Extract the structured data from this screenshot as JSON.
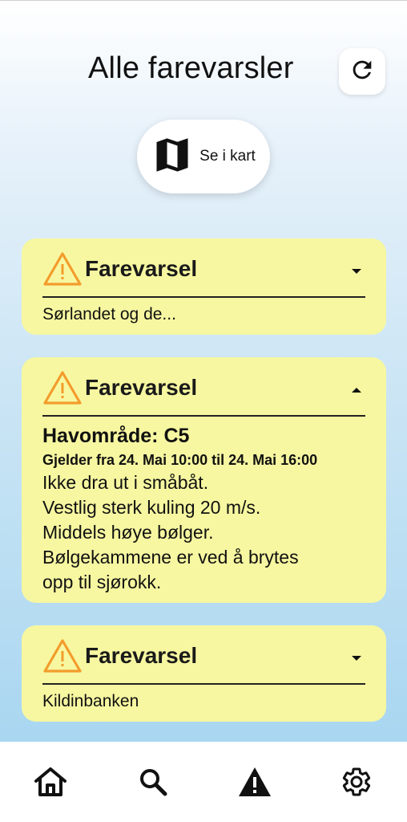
{
  "header": {
    "title": "Alle farevarsler",
    "refresh_icon": "refresh-icon"
  },
  "map_button": {
    "icon": "map-icon",
    "label": "Se i kart"
  },
  "colors": {
    "card_background": "#f7f7a1",
    "warning_orange": "#f39c2c"
  },
  "warnings": [
    {
      "title": "Farevarsel",
      "expanded": false,
      "summary": "Sørlandet og de..."
    },
    {
      "title": "Farevarsel",
      "expanded": true,
      "area": "Havområde: C5",
      "valid": "Gjelder fra 24. Mai 10:00 til 24. Mai 16:00",
      "description": [
        "Ikke dra ut i småbåt.",
        "Vestlig sterk kuling 20 m/s.",
        "Middels høye bølger.",
        "Bølgekammene er ved å brytes",
        "opp til sjørokk."
      ]
    },
    {
      "title": "Farevarsel",
      "expanded": false,
      "summary": "Kildinbanken"
    }
  ],
  "bottom_nav": [
    {
      "name": "home",
      "icon": "home-icon"
    },
    {
      "name": "search",
      "icon": "search-icon"
    },
    {
      "name": "warnings",
      "icon": "warning-icon",
      "active": true
    },
    {
      "name": "settings",
      "icon": "settings-icon"
    }
  ]
}
